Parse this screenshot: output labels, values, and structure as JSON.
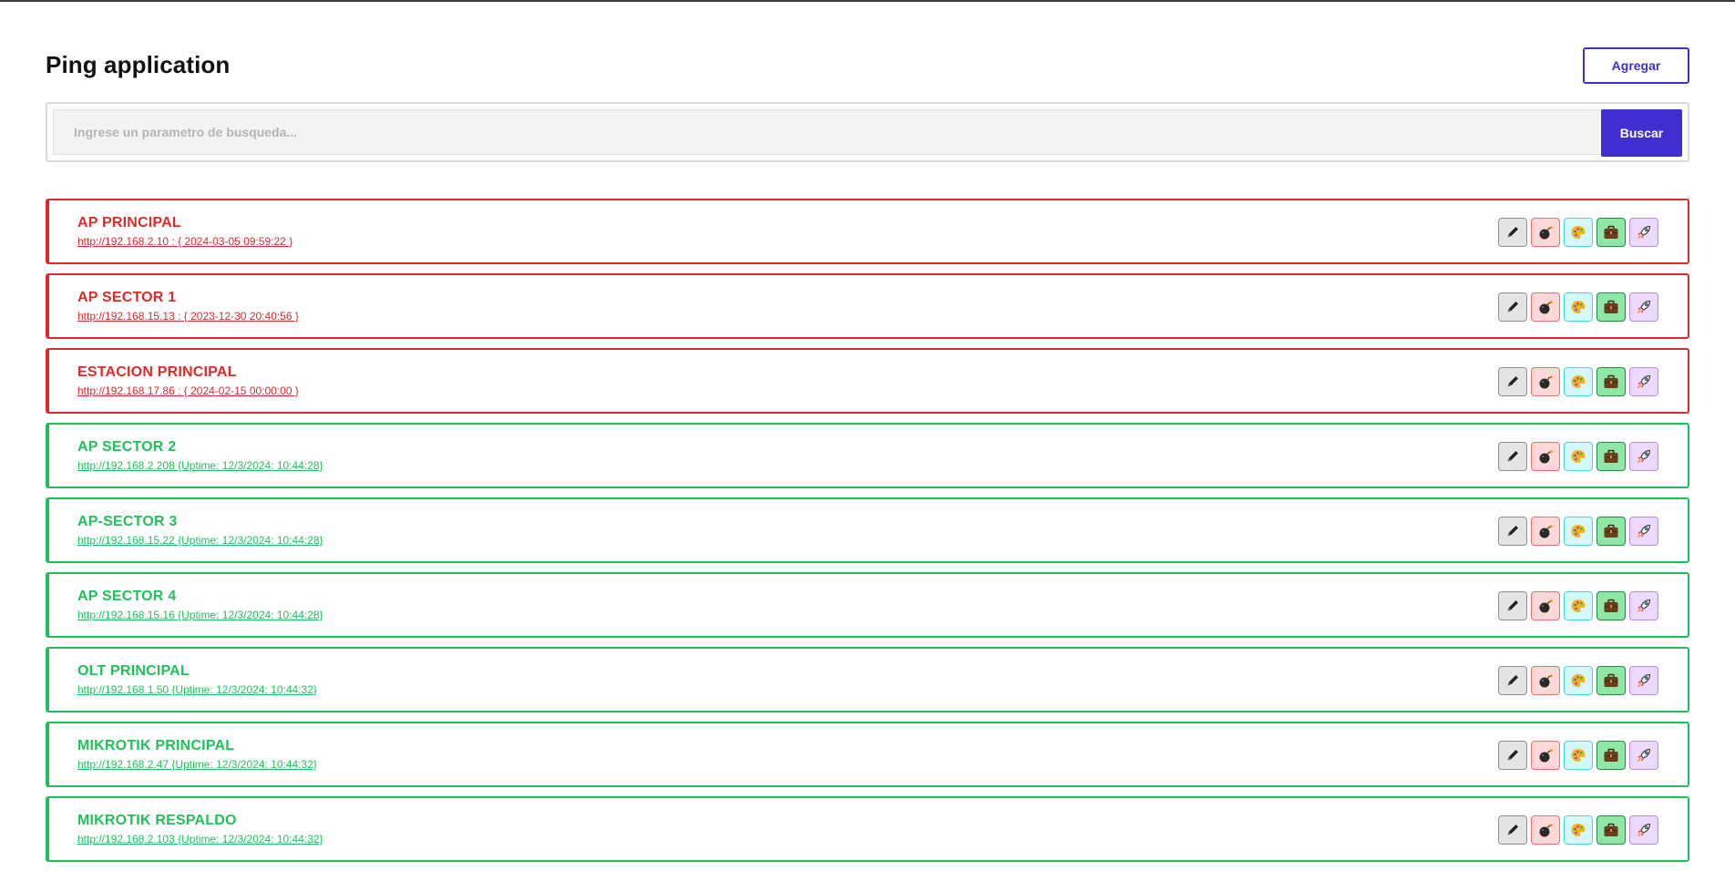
{
  "header": {
    "title": "Ping application",
    "add_label": "Agregar"
  },
  "search": {
    "placeholder": "Ingrese un parametro de busqueda...",
    "value": "",
    "button_label": "Buscar"
  },
  "status_colors": {
    "down": "#dc2b2b",
    "up": "#22c05a"
  },
  "action_icons": [
    "edit-icon",
    "bomb-icon",
    "palette-icon",
    "briefcase-icon",
    "rocket-icon"
  ],
  "devices": [
    {
      "name": "AP PRINCIPAL",
      "status": "down",
      "detail": "http://192.168.2.10 : { 2024-03-05 09:59:22 }"
    },
    {
      "name": "AP SECTOR 1",
      "status": "down",
      "detail": "http://192.168.15.13 : { 2023-12-30 20:40:56 }"
    },
    {
      "name": "ESTACION PRINCIPAL",
      "status": "down",
      "detail": "http://192.168.17.86 : { 2024-02-15 00:00:00 }"
    },
    {
      "name": "AP SECTOR 2",
      "status": "up",
      "detail": "http://192.168.2.208 {Uptime: 12/3/2024: 10:44:28}"
    },
    {
      "name": "AP-SECTOR 3",
      "status": "up",
      "detail": "http://192.168.15.22 {Uptime: 12/3/2024: 10:44:28}"
    },
    {
      "name": "AP SECTOR 4",
      "status": "up",
      "detail": "http://192.168.15.16 {Uptime: 12/3/2024: 10:44:28}"
    },
    {
      "name": "OLT PRINCIPAL",
      "status": "up",
      "detail": "http://192.168.1.50 {Uptime: 12/3/2024: 10:44:32}"
    },
    {
      "name": "MIKROTIK PRINCIPAL",
      "status": "up",
      "detail": "http://192.168.2.47 {Uptime: 12/3/2024: 10:44:32}"
    },
    {
      "name": "MIKROTIK RESPALDO",
      "status": "up",
      "detail": "http://192.168.2.103 {Uptime: 12/3/2024: 10:44:32}"
    }
  ]
}
